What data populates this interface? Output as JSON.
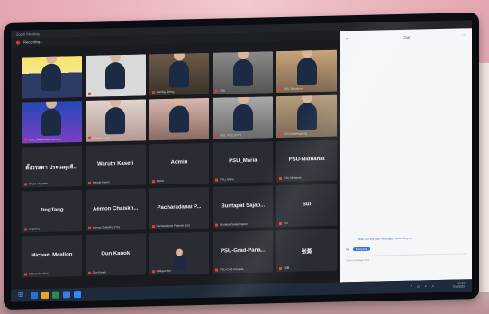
{
  "window": {
    "title": "Zoom Meeting",
    "recording_label": "Recording..."
  },
  "chat": {
    "title": "Chat",
    "message": "Who can see your messages? Recording on",
    "to_label": "To:",
    "to_recipient": "Everyone",
    "input_placeholder": "Type message here..."
  },
  "participants": [
    {
      "name": "",
      "label": "",
      "video": "v1"
    },
    {
      "name": "",
      "label": "Rajamangala Karot",
      "video": "v2"
    },
    {
      "name": "",
      "label": "Jiaming Zheng",
      "video": "v3"
    },
    {
      "name": "",
      "label": "Ghy",
      "video": "v4"
    },
    {
      "name": "",
      "label": "PSU-Teepakorn",
      "video": "v5"
    },
    {
      "name": "",
      "label": "PSU_Sasipamuan Juntuan",
      "video": "v6"
    },
    {
      "name": "",
      "label": "Hussein Xuan",
      "video": "v7"
    },
    {
      "name": "",
      "label": "",
      "video": "v8"
    },
    {
      "name": "",
      "label": "KDY_PSU_ETTU",
      "video": "v9"
    },
    {
      "name": "",
      "label": "PSU-Kammaphong",
      "video": "v10"
    },
    {
      "name": "ตั้งวรลดา ประณตุยลี...",
      "label": "Prasin Ungsittul",
      "video": ""
    },
    {
      "name": "Waruth Kaseri",
      "label": "Waruth Kaseri",
      "video": ""
    },
    {
      "name": "Admin",
      "label": "Admin",
      "video": ""
    },
    {
      "name": "PSU_Maria",
      "label": "PSU_Maria",
      "video": ""
    },
    {
      "name": "PSU-Nidhanat",
      "label": "PSU-Nidhanat",
      "video": ""
    },
    {
      "name": "JingTang",
      "label": "JingTang",
      "video": ""
    },
    {
      "name": "Aemon Chaiskh...",
      "label": "Aemon Chaiskhul (TU)",
      "video": ""
    },
    {
      "name": "Pacharadanai P...",
      "label": "Pacharadanai Pattanai (AU)",
      "video": ""
    },
    {
      "name": "Buntapat Sajap...",
      "label": "Buntapat Sajapongpan",
      "video": ""
    },
    {
      "name": "Sui",
      "label": "Sui",
      "video": ""
    },
    {
      "name": "Michael Meallon",
      "label": "Michael Meallon",
      "video": ""
    },
    {
      "name": "Oun Kanok",
      "label": "Oun Kanok",
      "video": ""
    },
    {
      "name": "",
      "label": "Chaiyut Kim",
      "video": "v11"
    },
    {
      "name": "PSU-Grad-Pana...",
      "label": "PSU-Grad-Panatda",
      "video": ""
    },
    {
      "name": "张蒸",
      "label": "张蒸",
      "video": ""
    }
  ],
  "taskbar": {
    "time": "16:01",
    "date": "7/10/2022"
  }
}
